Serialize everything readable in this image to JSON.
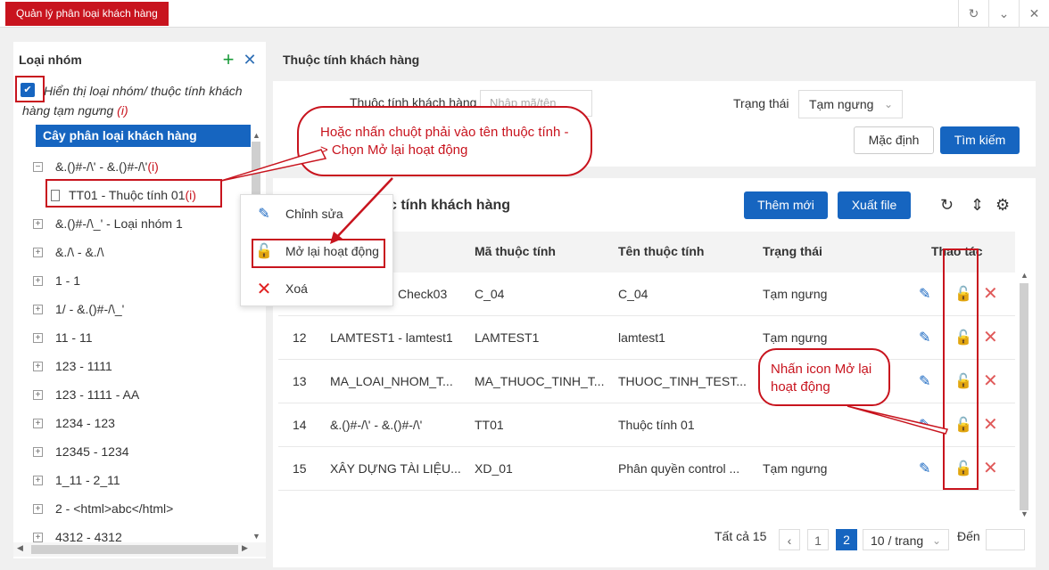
{
  "app_tab": "Quản lý phân loại khách hàng",
  "top_icons": [
    "refresh-icon",
    "chevron-down-icon",
    "close-icon"
  ],
  "left": {
    "title": "Loại nhóm",
    "show_inactive_label": "Hiển thị loại nhóm/ thuộc tính khách hàng tạm ngưng",
    "show_inactive_marker": "(i)",
    "tree_header": "Cây phân loại khách hàng",
    "tree": [
      {
        "toggle": "−",
        "label": "&.()#-/\\' - &.()#-/\\'",
        "marker": "(i)"
      },
      {
        "toggle": "",
        "label": "TT01 - Thuộc tính 01",
        "marker": "(i)",
        "leaf": true
      },
      {
        "toggle": "+",
        "label": "&.()#-/\\_' - Loại nhóm 1",
        "marker": ""
      },
      {
        "toggle": "+",
        "label": "&./\\ - &./\\",
        "marker": ""
      },
      {
        "toggle": "+",
        "label": "1 - 1",
        "marker": ""
      },
      {
        "toggle": "+",
        "label": "1/ - &.()#-/\\_'",
        "marker": ""
      },
      {
        "toggle": "+",
        "label": "11 - 11",
        "marker": ""
      },
      {
        "toggle": "+",
        "label": "123 - 1111",
        "marker": ""
      },
      {
        "toggle": "+",
        "label": "123 - 1111 - AA",
        "marker": ""
      },
      {
        "toggle": "+",
        "label": "1234 - 123",
        "marker": ""
      },
      {
        "toggle": "+",
        "label": "12345 - 1234",
        "marker": ""
      },
      {
        "toggle": "+",
        "label": "1_11 - 2_11",
        "marker": ""
      },
      {
        "toggle": "+",
        "label": "2 - <html>abc</html>",
        "marker": ""
      },
      {
        "toggle": "+",
        "label": "4312 - 4312",
        "marker": ""
      }
    ]
  },
  "context_menu": {
    "edit": "Chỉnh sửa",
    "reopen": "Mở lại hoạt động",
    "delete": "Xoá"
  },
  "callout1": "Hoặc nhấn chuột phải vào tên thuộc tính -> Chọn Mở lại hoạt động",
  "callout2": "Nhấn icon Mở lại hoạt động",
  "filter": {
    "section_title": "Thuộc tính khách hàng",
    "attr_label": "Thuộc tính khách hàng",
    "attr_placeholder": "Nhập mã/tên",
    "status_label": "Trạng thái",
    "status_value": "Tạm ngưng",
    "reset_button": "Mặc định",
    "search_button": "Tìm kiếm"
  },
  "list": {
    "title": "Danh sách thuộc tính khách hàng",
    "add_button": "Thêm mới",
    "export_button": "Xuất file",
    "columns": {
      "code": "Mã thuộc tính",
      "name": "Tên thuộc tính",
      "status": "Trạng thái",
      "actions": "Thao tác"
    },
    "rows": [
      {
        "stt": "",
        "group": "Check03",
        "code": "C_04",
        "name": "C_04",
        "status": "Tạm ngưng"
      },
      {
        "stt": "12",
        "group": "LAMTEST1 - lamtest1",
        "code": "LAMTEST1",
        "name": "lamtest1",
        "status": "Tạm ngưng"
      },
      {
        "stt": "13",
        "group": "MA_LOAI_NHOM_T...",
        "code": "MA_THUOC_TINH_T...",
        "name": "THUOC_TINH_TEST...",
        "status": ""
      },
      {
        "stt": "14",
        "group": "&.()#-/\\' - &.()#-/\\'",
        "code": "TT01",
        "name": "Thuộc tính 01",
        "status": ""
      },
      {
        "stt": "15",
        "group": "XÂY DỰNG TÀI LIỆU...",
        "code": "XD_01",
        "name": "Phân quyền control ...",
        "status": "Tạm ngưng"
      }
    ]
  },
  "pager": {
    "total": "Tất cả 15",
    "page1": "1",
    "page2": "2",
    "page_size": "10 / trang",
    "goto_label": "Đến"
  },
  "colors": {
    "accent": "#1665c0",
    "brand": "#c8141e",
    "delete": "#e05a5a"
  }
}
